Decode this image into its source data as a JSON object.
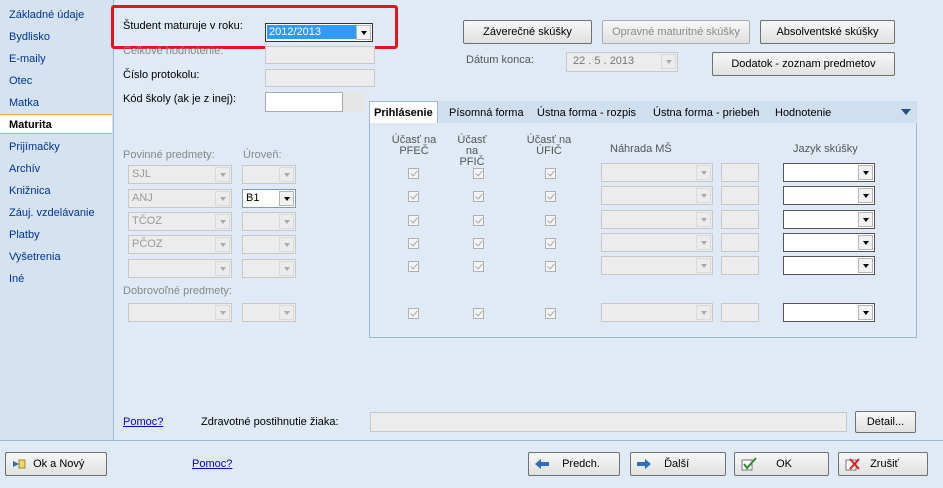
{
  "sidebar": {
    "items": [
      {
        "label": "Základné údaje",
        "active": false
      },
      {
        "label": "Bydlisko",
        "active": false
      },
      {
        "label": "E-maily",
        "active": false
      },
      {
        "label": "Otec",
        "active": false
      },
      {
        "label": "Matka",
        "active": false
      },
      {
        "label": "Maturita",
        "active": true
      },
      {
        "label": "Prijímačky",
        "active": false
      },
      {
        "label": "Archív",
        "active": false
      },
      {
        "label": "Knižnica",
        "active": false
      },
      {
        "label": "Záuj. vzdelávanie",
        "active": false
      },
      {
        "label": "Platby",
        "active": false
      },
      {
        "label": "Vyšetrenia",
        "active": false
      },
      {
        "label": "Iné",
        "active": false
      }
    ]
  },
  "form": {
    "year_label": "Študent maturuje v roku:",
    "year_value": "2012/2013",
    "overall_label": "Celkové hodnotenie:",
    "protocol_label": "Číslo protokolu:",
    "school_code_label": "Kód školy (ak je z inej):",
    "mandatory_label": "Povinné predmety:",
    "level_label": "Úroveň:",
    "mandatory_subjects": [
      "SJL",
      "ANJ",
      "TČOZ",
      "PČOZ",
      ""
    ],
    "mandatory_levels": [
      "",
      "B1",
      "",
      "",
      ""
    ],
    "optional_label": "Dobrovoľné predmety:"
  },
  "header_buttons": {
    "final_exams": "Záverečné skúšky",
    "retake_exams": "Opravné maturitné skúšky",
    "graduate_exams": "Absolventské skúšky",
    "end_date_label": "Dátum konca:",
    "end_date_value": "22 .   5 . 2013",
    "appendix": "Dodatok - zoznam predmetov"
  },
  "tabs": [
    {
      "label": "Prihlásenie",
      "active": true
    },
    {
      "label": "Písomná forma",
      "active": false
    },
    {
      "label": "Ústna forma - rozpis",
      "active": false
    },
    {
      "label": "Ústna forma - priebeh",
      "active": false
    },
    {
      "label": "Hodnotenie",
      "active": false
    }
  ],
  "grid": {
    "col_pfec": "Účasť na PFEČ",
    "col_pfic": "Účasť na PFIČ",
    "col_ufic": "Účasť na ÚFIČ",
    "col_nahrada": "Náhrada MŠ",
    "col_jazyk": "Jazyk skúšky"
  },
  "footer": {
    "help_link": "Pomoc?",
    "health_label": "Zdravotné postihnutie žiaka:",
    "detail_button": "Detail..."
  },
  "bottom": {
    "ok_new": "Ok a Nový",
    "help_link": "Pomoc?",
    "prev": "Predch.",
    "next": "Ďalší",
    "ok": "OK",
    "cancel": "Zrušiť"
  }
}
